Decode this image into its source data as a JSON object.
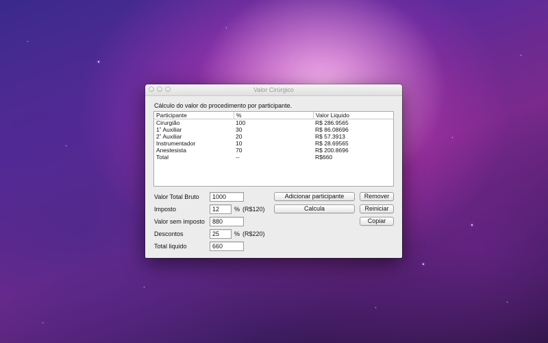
{
  "window": {
    "title": "Valor Cirúrgico"
  },
  "heading": "Cálculo do valor do procedimento por participante.",
  "table": {
    "columns": [
      "Participante",
      "%",
      "Valor Liquido"
    ],
    "rows": [
      [
        "Cirurgião",
        "100",
        "R$ 286.9565"
      ],
      [
        "1˚ Auxiliar",
        "30",
        "R$ 86.08696"
      ],
      [
        "2˚ Auxiliar",
        "20",
        "R$ 57.3913"
      ],
      [
        "Instrumentador",
        "10",
        "R$ 28.69565"
      ],
      [
        "Anestesista",
        "70",
        "R$ 200.8696"
      ],
      [
        "Total",
        "--",
        "R$660"
      ]
    ]
  },
  "form": {
    "valor_total_bruto": {
      "label": "Valor Total Bruto",
      "value": "1000"
    },
    "imposto": {
      "label": "Imposto",
      "value": "12",
      "percent": "%",
      "amount": "(R$120)"
    },
    "valor_sem_imposto": {
      "label": "Valor sem imposto",
      "value": "880"
    },
    "descontos": {
      "label": "Descontos",
      "value": "25",
      "percent": "%",
      "amount": "(R$220)"
    },
    "total_liquido": {
      "label": "Total liquido",
      "value": "660"
    }
  },
  "buttons": {
    "adicionar": "Adicionar participante",
    "remover": "Remover",
    "calcula": "Calcula",
    "reiniciar": "Reiniciar",
    "copiar": "Copiar"
  }
}
